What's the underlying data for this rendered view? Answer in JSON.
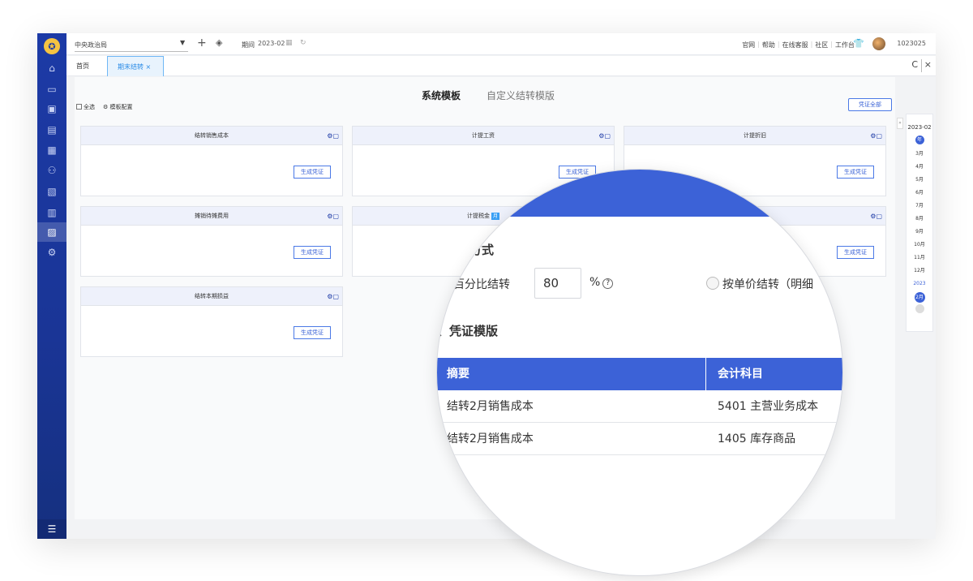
{
  "topbar": {
    "company": "中央政治局",
    "period_label": "期间",
    "period_value": "2023-02",
    "links": [
      "官网",
      "帮助",
      "在线客服",
      "社区",
      "工作台"
    ],
    "user_id": "1023025"
  },
  "tabs": {
    "home": "首页",
    "active": "期末结转 ×"
  },
  "content": {
    "template_tabs": {
      "system": "系统模板",
      "custom": "自定义结转模版"
    },
    "options": {
      "select_all": "全选",
      "template_config": "模板配置"
    },
    "generate_all": "凭证全部"
  },
  "cards": [
    {
      "title": "结转销售成本",
      "button": "生成凭证"
    },
    {
      "title": "计提工资",
      "button": "生成凭证"
    },
    {
      "title": "计提折旧",
      "button": "生成凭证"
    },
    {
      "title": "摊销待摊费用",
      "button": "生成凭证"
    },
    {
      "title": "计提税金",
      "badge": "月",
      "button": ""
    },
    {
      "title": "",
      "button": "生成凭证"
    },
    {
      "title": "结转本期损益",
      "button": "生成凭证"
    }
  ],
  "calendar": {
    "year": "2023-02",
    "months": [
      "3月",
      "4月",
      "5月",
      "6月",
      "7月",
      "8月",
      "9月",
      "10月",
      "11月",
      "12月"
    ],
    "prev_year_label": "2023",
    "current": "2月",
    "dot_label": "年"
  },
  "magnifier": {
    "section1": "方式",
    "opt1": "百分比结转",
    "percent_value": "80",
    "percent_sign": "%",
    "help": "?",
    "opt2": "按单价结转（明细",
    "section2": "、凭证模版",
    "table": {
      "headers": [
        "摘要",
        "会计科目"
      ],
      "rows": [
        [
          "结转2月销售成本",
          "5401 主营业务成本"
        ],
        [
          "结转2月销售成本",
          "1405 库存商品"
        ]
      ]
    }
  },
  "colors": {
    "sidebar": "#1c3aa6",
    "accent": "#3c62d7",
    "tab_active": "#2a8be6"
  }
}
